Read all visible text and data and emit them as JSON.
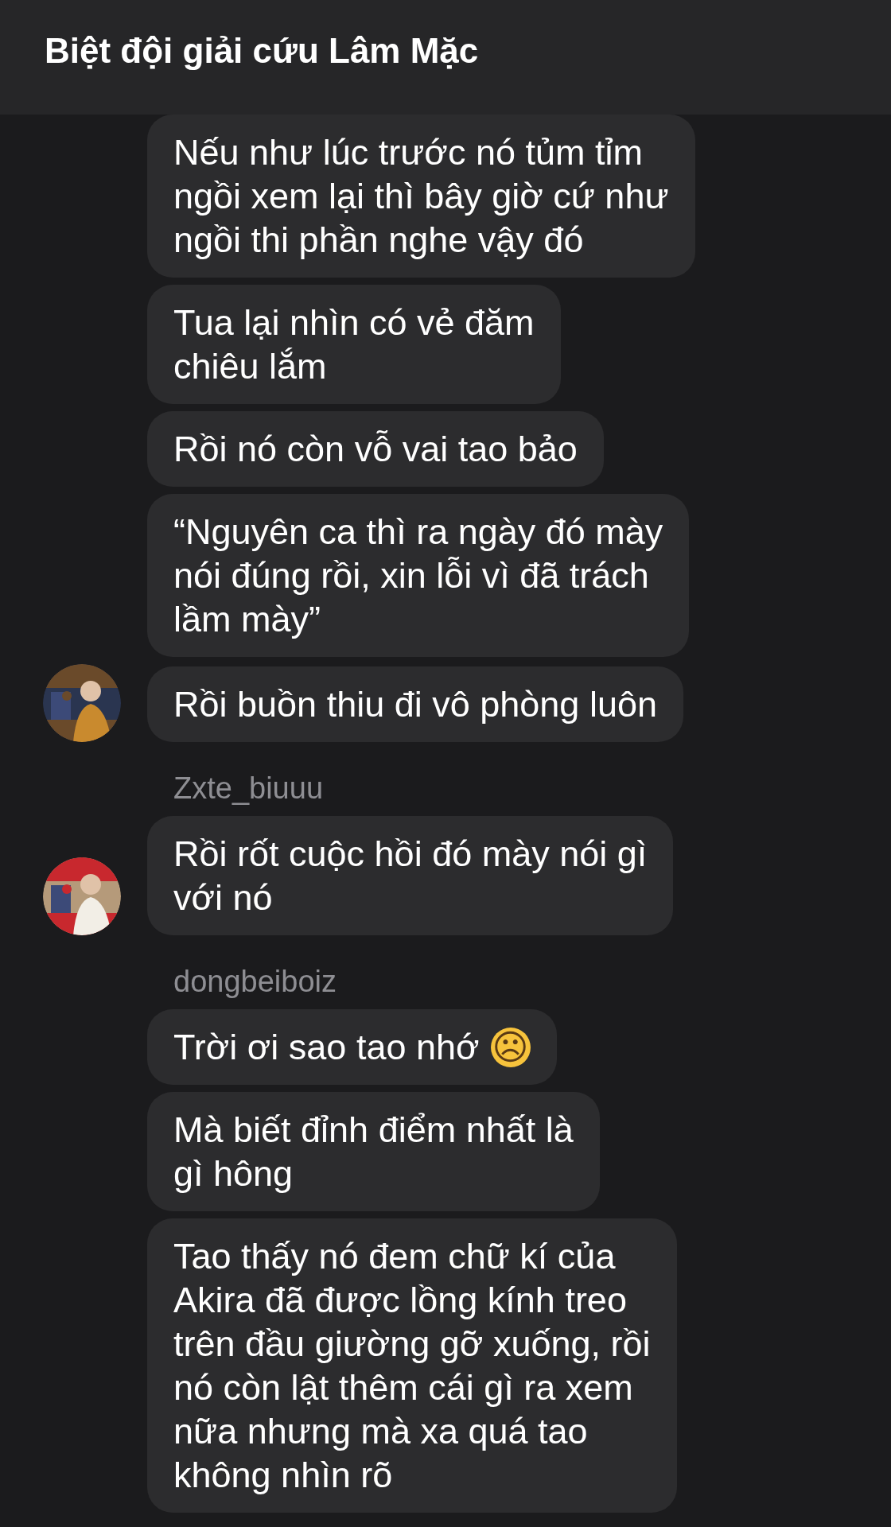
{
  "header": {
    "title": "Biệt đội giải cứu Lâm Mặc"
  },
  "groups": [
    {
      "avatar_visible": true,
      "messages": [
        {
          "text": "Nếu như lúc trước nó tủm tỉm\nngồi xem lại thì bây giờ cứ như\nngồi thi phần nghe vậy đó"
        },
        {
          "text": "Tua lại nhìn có vẻ đăm\nchiêu lắm"
        },
        {
          "text": "Rồi nó còn vỗ vai tao bảo"
        },
        {
          "text": "“Nguyên ca thì ra ngày đó mày\nnói đúng rồi, xin lỗi vì đã trách\nlầm mày”"
        },
        {
          "text": "Rồi buồn thiu đi vô phòng luôn"
        }
      ]
    },
    {
      "sender": "Zxte_biuuu",
      "avatar_visible": true,
      "messages": [
        {
          "text": "Rồi rốt cuộc hồi đó mày nói gì\nvới nó"
        }
      ]
    },
    {
      "sender": "dongbeiboiz",
      "avatar_visible": false,
      "messages": [
        {
          "text": "Trời ơi sao tao nhớ",
          "emoji": "☹"
        },
        {
          "text": "Mà biết đỉnh điểm nhất là\ngì hông"
        },
        {
          "text": "Tao thấy nó đem chữ kí của\nAkira đã được lồng kính treo\ntrên đầu giường gỡ xuống, rồi\nnó còn lật thêm cái gì ra xem\nnữa nhưng mà xa quá tao\nkhông nhìn rõ"
        }
      ]
    }
  ]
}
